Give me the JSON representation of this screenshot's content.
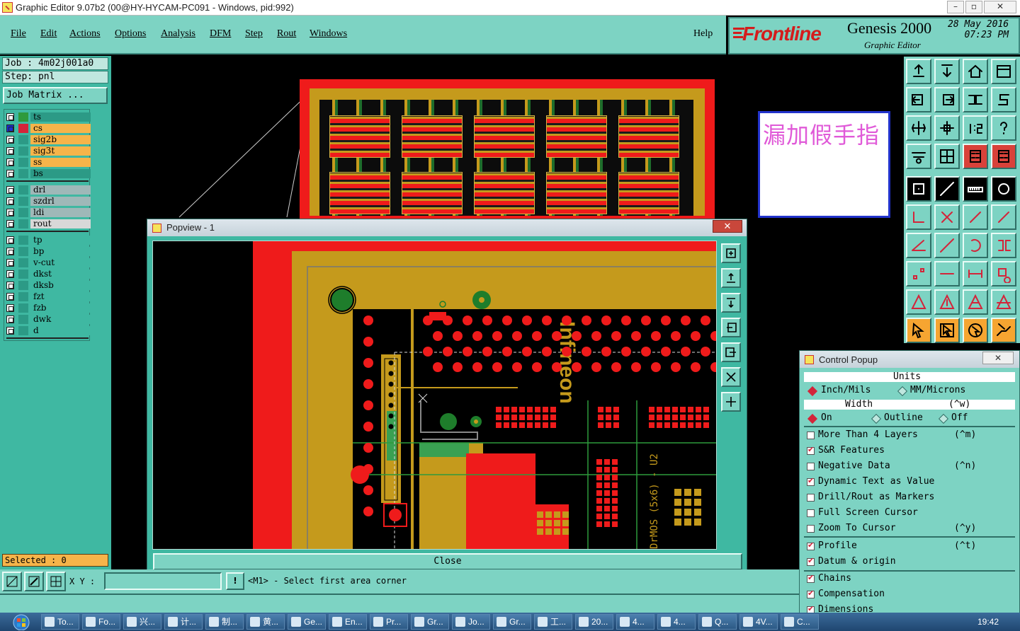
{
  "window": {
    "title": "Graphic Editor 9.07b2 (00@HY-HYCAM-PC091 - Windows, pid:992)"
  },
  "menu": {
    "items": [
      "File",
      "Edit",
      "Actions",
      "Options",
      "Analysis",
      "DFM",
      "Step",
      "Rout",
      "Windows"
    ],
    "help": "Help"
  },
  "logo": {
    "brand": "Frontline",
    "product": "Genesis 2000",
    "subtitle": "Graphic Editor",
    "date": "28 May 2016",
    "time": "07:23 PM"
  },
  "job": {
    "job_label": "Job : 4m02j001a0",
    "step_label": "Step: pnl",
    "matrix_button": "Job Matrix ..."
  },
  "layers": {
    "group1": [
      {
        "name": "ts",
        "color": "#2c9a86"
      },
      {
        "name": "cs",
        "color": "#f6b44a"
      },
      {
        "name": "sig2b",
        "color": "#f6b44a"
      },
      {
        "name": "sig3t",
        "color": "#f6b44a"
      },
      {
        "name": "ss",
        "color": "#f6b44a"
      },
      {
        "name": "bs",
        "color": "#2c9a86"
      }
    ],
    "group2": [
      {
        "name": "drl",
        "color": "#9fb8b8"
      },
      {
        "name": "szdrl",
        "color": "#9fb8b8"
      },
      {
        "name": "ldi",
        "color": "#9fb8b8"
      },
      {
        "name": "rout",
        "color": "#d8d8d8"
      }
    ],
    "group3": [
      {
        "name": "tp",
        "color": "#3fb8a2"
      },
      {
        "name": "bp",
        "color": "#3fb8a2"
      },
      {
        "name": "v-cut",
        "color": "#3fb8a2"
      },
      {
        "name": "dkst",
        "color": "#3fb8a2"
      },
      {
        "name": "dksb",
        "color": "#3fb8a2"
      },
      {
        "name": "fzt",
        "color": "#3fb8a2"
      },
      {
        "name": "fzb",
        "color": "#3fb8a2"
      },
      {
        "name": "dwk",
        "color": "#3fb8a2"
      },
      {
        "name": "d",
        "color": "#3fb8a2"
      }
    ]
  },
  "selected": "Selected : 0",
  "note": "漏加假手指",
  "popview": {
    "title": "Popview - 1",
    "close_button": "Close",
    "silkscreen_text": "Infineon",
    "part_text": "DrMOS (5x6) - U2"
  },
  "bottom": {
    "xy_label": "X Y :",
    "xy_value": "",
    "msg_icon": "!",
    "message": "<M1> - Select first area corner"
  },
  "control_popup": {
    "title": "Control Popup",
    "units_header": "Units",
    "units_inch": "Inch/Mils",
    "units_mm": "MM/Microns",
    "width_header": "Width",
    "width_shortcut": "(^w)",
    "width_on": "On",
    "width_outline": "Outline",
    "width_off": "Off",
    "options": [
      {
        "label": "More Than 4 Layers",
        "shortcut": "(^m)",
        "checked": false
      },
      {
        "label": "S&R Features",
        "shortcut": "",
        "checked": true
      },
      {
        "label": "Negative Data",
        "shortcut": "(^n)",
        "checked": false
      },
      {
        "label": "Dynamic Text as Value",
        "shortcut": "",
        "checked": true
      },
      {
        "label": "Drill/Rout as Markers",
        "shortcut": "",
        "checked": false
      },
      {
        "label": "Full Screen Cursor",
        "shortcut": "",
        "checked": false
      },
      {
        "label": "Zoom To Cursor",
        "shortcut": "(^y)",
        "checked": false
      }
    ],
    "options2": [
      {
        "label": "Profile",
        "shortcut": "(^t)",
        "checked": true
      },
      {
        "label": "Datum & origin",
        "shortcut": "",
        "checked": true
      }
    ],
    "options3": [
      {
        "label": "Chains",
        "shortcut": "",
        "checked": true
      },
      {
        "label": "Compensation",
        "shortcut": "",
        "checked": true
      },
      {
        "label": "Dimensions",
        "shortcut": "",
        "checked": true
      }
    ]
  },
  "taskbar": {
    "tasks": [
      "To...",
      "Fo...",
      "兴...",
      "计...",
      "制...",
      "黄...",
      "Ge...",
      "En...",
      "Pr...",
      "Gr...",
      "Jo...",
      "Gr...",
      "工...",
      "20...",
      "4...",
      "4...",
      "Q...",
      "4V...",
      "C..."
    ],
    "clock": "19:42"
  }
}
